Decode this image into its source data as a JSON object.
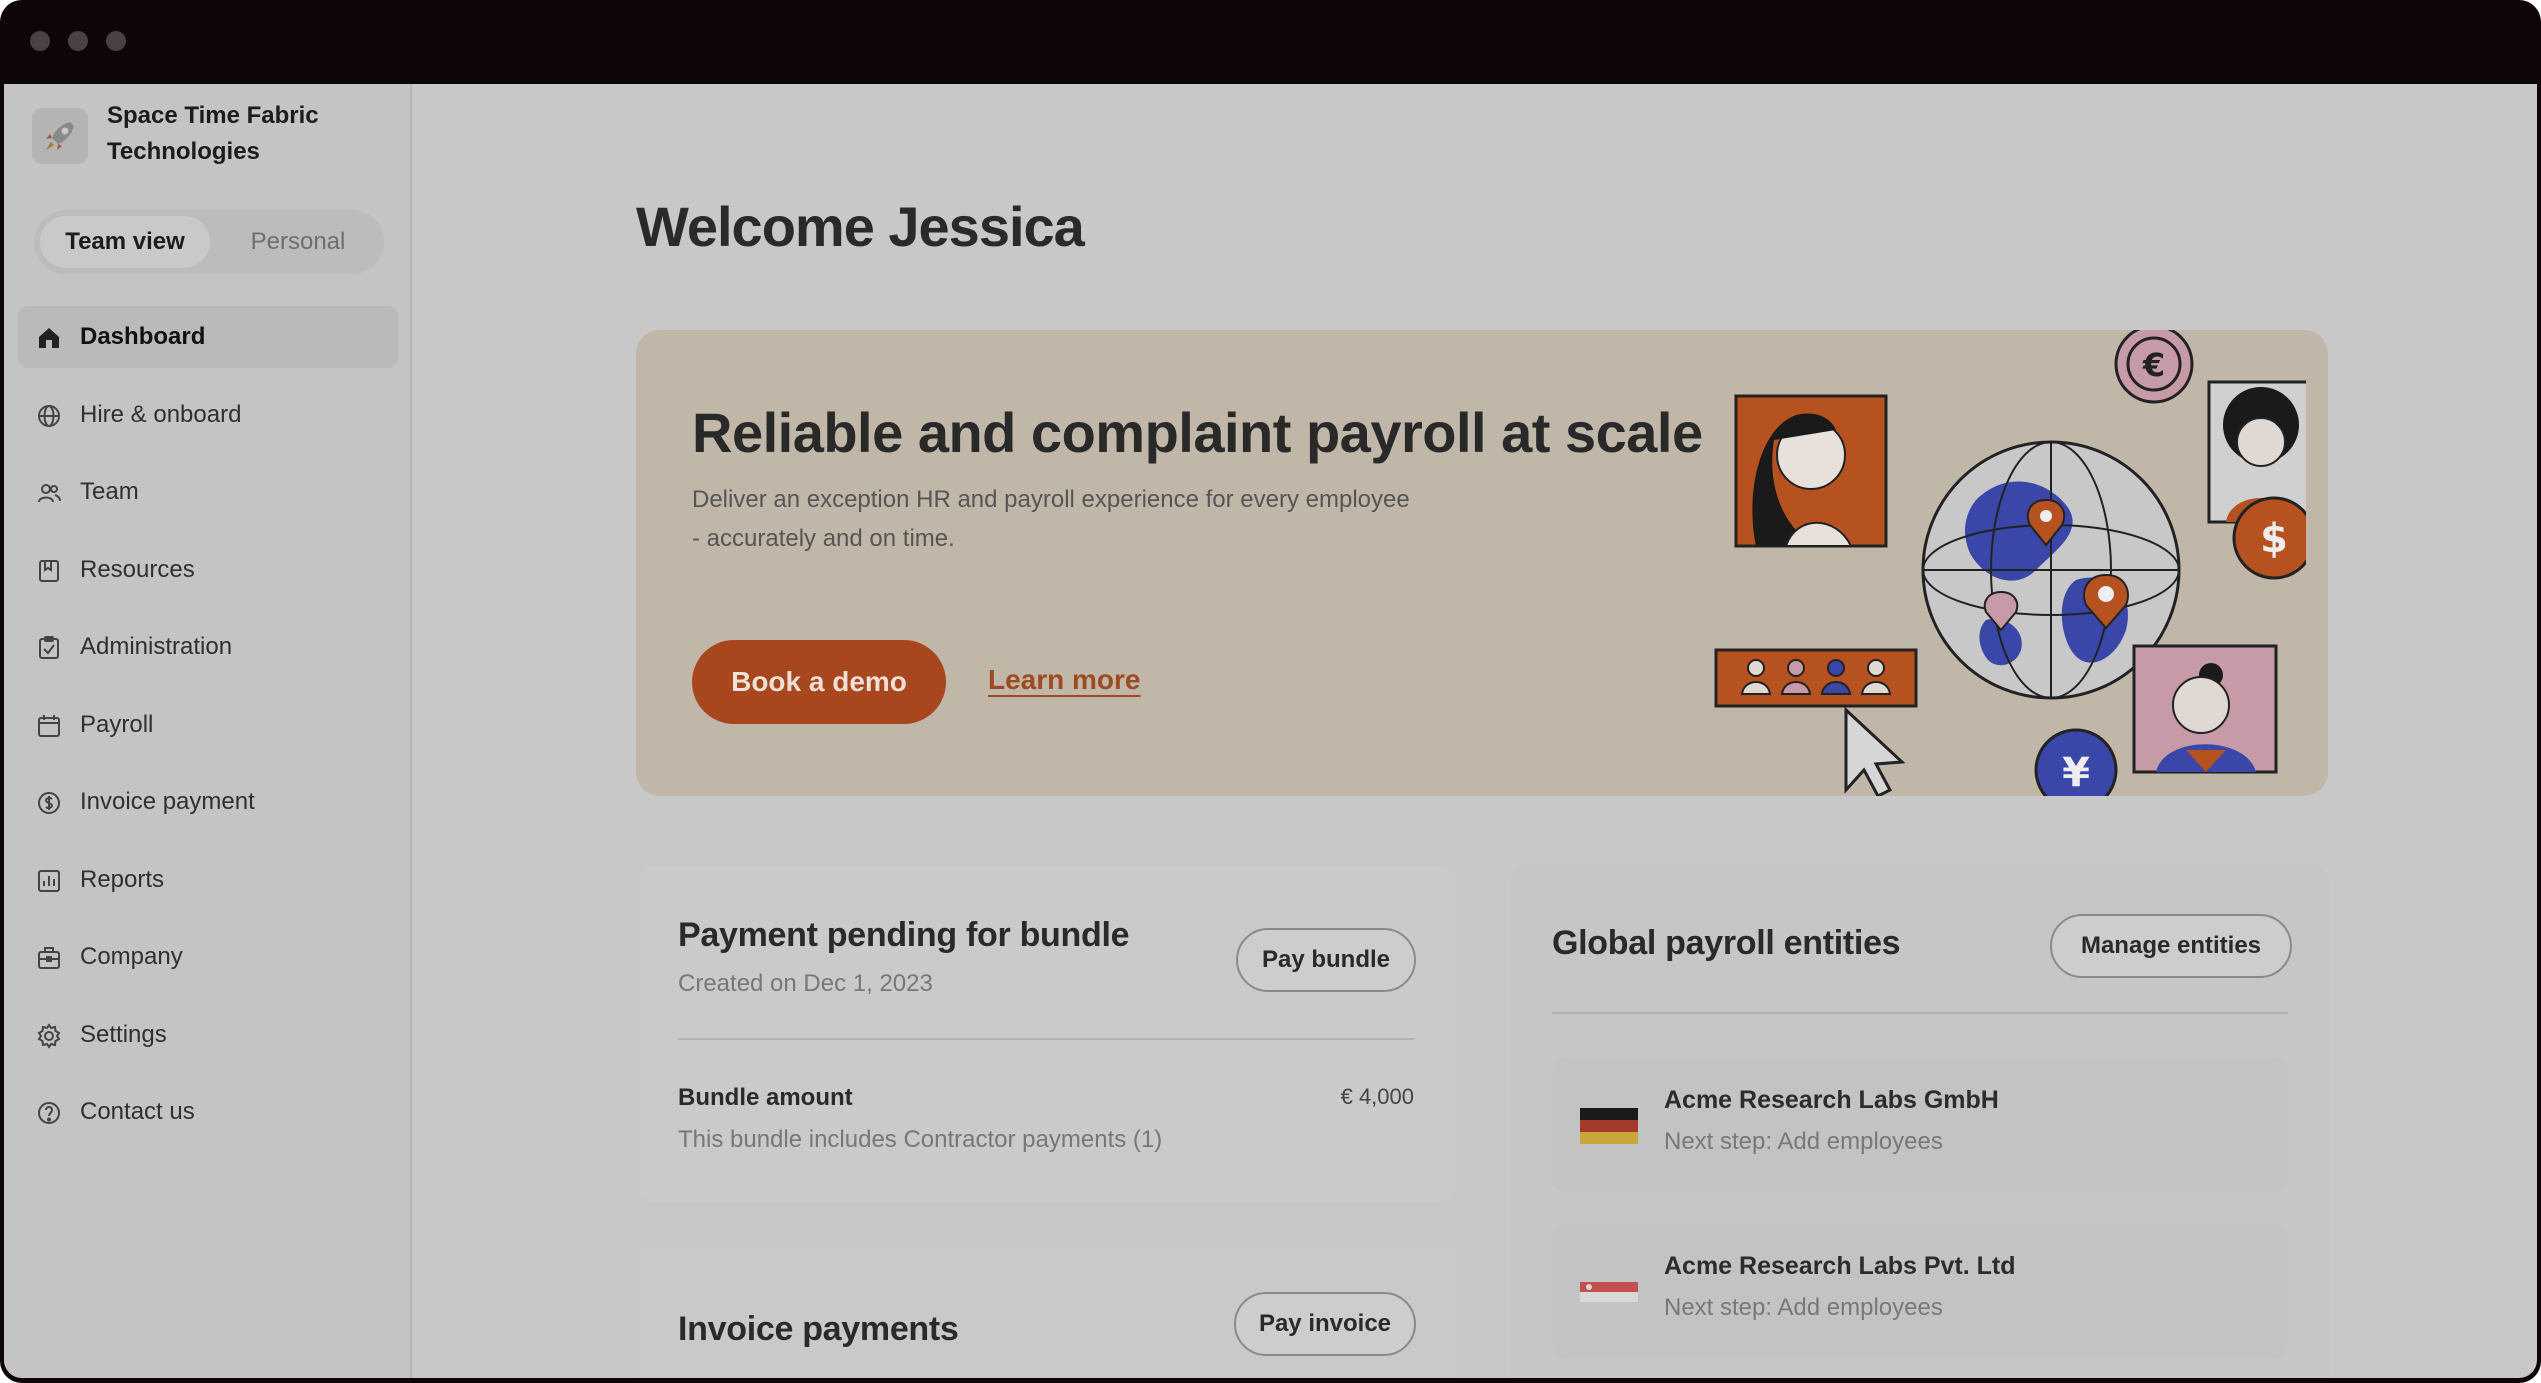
{
  "window": {
    "controls": [
      "close",
      "minimize",
      "maximize"
    ]
  },
  "sidebar": {
    "company_name": "Space Time Fabric Technologies",
    "logo_icon": "rocket-icon",
    "view_toggle": {
      "active": "Team view",
      "inactive": "Personal"
    },
    "items": [
      {
        "label": "Dashboard",
        "icon": "home-icon",
        "active": true
      },
      {
        "label": "Hire & onboard",
        "icon": "globe-icon"
      },
      {
        "label": "Team",
        "icon": "users-icon"
      },
      {
        "label": "Resources",
        "icon": "book-icon"
      },
      {
        "label": "Administration",
        "icon": "clipboard-check-icon"
      },
      {
        "label": "Payroll",
        "icon": "calendar-icon"
      },
      {
        "label": "Invoice payment",
        "icon": "dollar-circle-icon"
      },
      {
        "label": "Reports",
        "icon": "bar-chart-icon"
      },
      {
        "label": "Company",
        "icon": "building-icon"
      },
      {
        "label": "Settings",
        "icon": "gear-icon"
      },
      {
        "label": "Contact us",
        "icon": "help-circle-icon"
      }
    ]
  },
  "main": {
    "welcome": "Welcome Jessica",
    "hero": {
      "title": "Reliable and complaint payroll at scale",
      "subtitle": "Deliver an exception HR and payroll experience for every employee - accurately and on time.",
      "primary_button": "Book a demo",
      "link": "Learn more"
    },
    "bundle_card": {
      "title": "Payment pending for bundle",
      "created": "Created on Dec 1, 2023",
      "button": "Pay bundle",
      "amount_label": "Bundle amount",
      "amount_value": "€ 4,000",
      "amount_note": "This bundle includes Contractor payments (1)"
    },
    "invoice_card": {
      "title": "Invoice payments",
      "button": "Pay invoice"
    },
    "entities_card": {
      "title": "Global payroll entities",
      "button": "Manage entities",
      "entities": [
        {
          "name": "Acme Research Labs GmbH",
          "step": "Next step: Add employees",
          "flag": "germany-flag-icon"
        },
        {
          "name": "Acme Research Labs Pvt. Ltd",
          "step": "Next step: Add employees",
          "flag": "singapore-flag-icon"
        }
      ]
    }
  },
  "colors": {
    "accent": "#a8461d",
    "hero_bg": "#c1b7a9",
    "overlay_dim": "#c8c8c8"
  }
}
